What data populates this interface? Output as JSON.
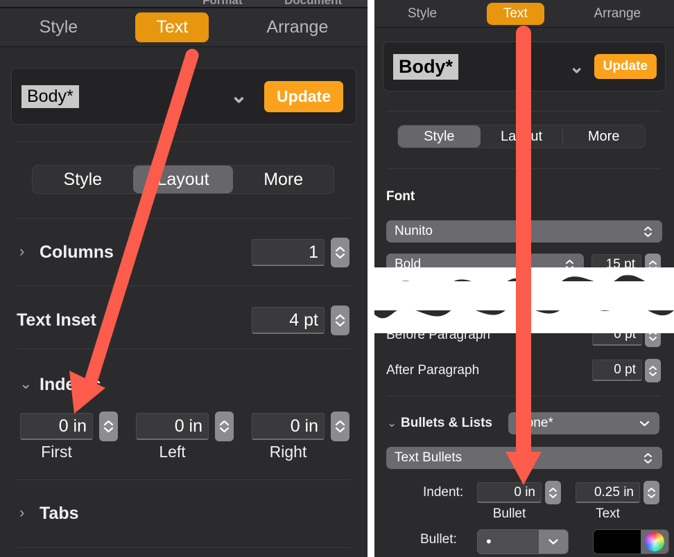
{
  "colors": {
    "accent_orange": "#e8960e",
    "update_orange": "#faa21b",
    "arrow_red": "#fb5c4c",
    "panel_bg": "#2b2b2d",
    "field_bg": "#3a3a3d",
    "stepper_gray": "#8b8b90",
    "dropdown_gray": "#6a6a6f",
    "style_name_bg": "#c9c9c9",
    "bullet_color_swatch": "#000000"
  },
  "menu_strip": {
    "format_label": "Format",
    "document_label": "Document"
  },
  "left_panel": {
    "tabs": [
      {
        "label": "Style",
        "active": false
      },
      {
        "label": "Text",
        "active": true
      },
      {
        "label": "Arrange",
        "active": false
      }
    ],
    "style_picker": {
      "style_name": "Body*",
      "chevron": "⌄",
      "update_label": "Update"
    },
    "segmented": [
      {
        "label": "Style",
        "active": false
      },
      {
        "label": "Layout",
        "active": true
      },
      {
        "label": "More",
        "active": false
      }
    ],
    "columns": {
      "disclosure": "›",
      "label": "Columns",
      "value": "1"
    },
    "text_inset": {
      "label": "Text Inset",
      "value": "4 pt"
    },
    "indents": {
      "disclosure": "⌄",
      "label": "Indents",
      "fields": [
        {
          "value": "0 in",
          "caption": "First"
        },
        {
          "value": "0 in",
          "caption": "Left"
        },
        {
          "value": "0 in",
          "caption": "Right"
        }
      ]
    },
    "tabs_section": {
      "disclosure": "›",
      "label": "Tabs"
    }
  },
  "right_panel": {
    "tabs": [
      {
        "label": "Style",
        "active": false
      },
      {
        "label": "Text",
        "active": true
      },
      {
        "label": "Arrange",
        "active": false
      }
    ],
    "style_picker": {
      "style_name": "Body*",
      "chevron": "⌄",
      "update_label": "Update"
    },
    "segmented": [
      {
        "label": "Style",
        "active": true
      },
      {
        "label": "Layout",
        "active": false
      },
      {
        "label": "More",
        "active": false
      }
    ],
    "font": {
      "section_label": "Font",
      "family": "Nunito",
      "weight": "Bold",
      "size": "15 pt"
    },
    "spacing": {
      "before_label": "Before Paragraph",
      "before_value": "0 pt",
      "after_label": "After Paragraph",
      "after_value": "0 pt"
    },
    "bullets_lists": {
      "disclosure": "⌄",
      "label": "Bullets & Lists",
      "preset": "None*",
      "bullet_type": "Text Bullets",
      "indent_label": "Indent:",
      "bullet_indent_value": "0 in",
      "bullet_indent_caption": "Bullet",
      "text_indent_value": "0.25 in",
      "text_indent_caption": "Text",
      "bullet_row_label": "Bullet:",
      "bullet_glyph": "•"
    }
  },
  "annotations": [
    {
      "name": "left-arrow-to-indents",
      "target": "Indents"
    },
    {
      "name": "right-arrow-to-bullet-indent",
      "target": "Indent: 0 in"
    }
  ]
}
